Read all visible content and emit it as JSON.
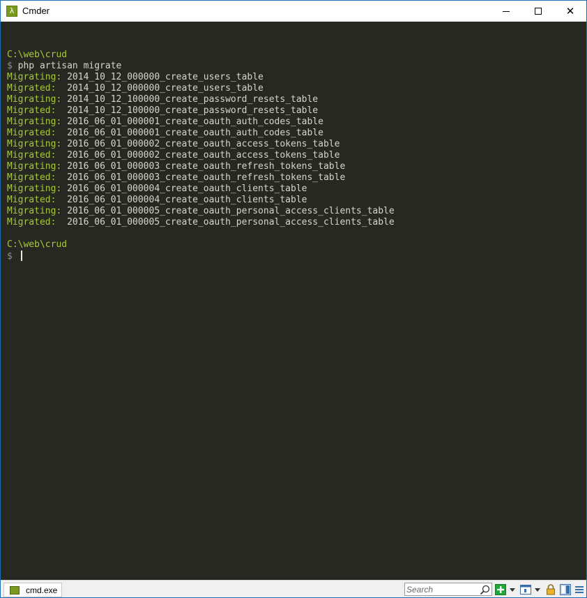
{
  "window": {
    "title": "Cmder",
    "app_icon_glyph": "λ"
  },
  "terminal": {
    "lines": [
      {
        "kind": "blank"
      },
      {
        "kind": "path",
        "text": "C:\\web\\crud"
      },
      {
        "kind": "prompt",
        "prompt": "$",
        "text": "php artisan migrate"
      },
      {
        "kind": "migration",
        "status": "Migrating:",
        "name": "2014_10_12_000000_create_users_table"
      },
      {
        "kind": "migration",
        "status": "Migrated: ",
        "name": "2014_10_12_000000_create_users_table"
      },
      {
        "kind": "migration",
        "status": "Migrating:",
        "name": "2014_10_12_100000_create_password_resets_table"
      },
      {
        "kind": "migration",
        "status": "Migrated: ",
        "name": "2014_10_12_100000_create_password_resets_table"
      },
      {
        "kind": "migration",
        "status": "Migrating:",
        "name": "2016_06_01_000001_create_oauth_auth_codes_table"
      },
      {
        "kind": "migration",
        "status": "Migrated: ",
        "name": "2016_06_01_000001_create_oauth_auth_codes_table"
      },
      {
        "kind": "migration",
        "status": "Migrating:",
        "name": "2016_06_01_000002_create_oauth_access_tokens_table"
      },
      {
        "kind": "migration",
        "status": "Migrated: ",
        "name": "2016_06_01_000002_create_oauth_access_tokens_table"
      },
      {
        "kind": "migration",
        "status": "Migrating:",
        "name": "2016_06_01_000003_create_oauth_refresh_tokens_table"
      },
      {
        "kind": "migration",
        "status": "Migrated: ",
        "name": "2016_06_01_000003_create_oauth_refresh_tokens_table"
      },
      {
        "kind": "migration",
        "status": "Migrating:",
        "name": "2016_06_01_000004_create_oauth_clients_table"
      },
      {
        "kind": "migration",
        "status": "Migrated: ",
        "name": "2016_06_01_000004_create_oauth_clients_table"
      },
      {
        "kind": "migration",
        "status": "Migrating:",
        "name": "2016_06_01_000005_create_oauth_personal_access_clients_table"
      },
      {
        "kind": "migration",
        "status": "Migrated: ",
        "name": "2016_06_01_000005_create_oauth_personal_access_clients_table"
      },
      {
        "kind": "blank"
      },
      {
        "kind": "path",
        "text": "C:\\web\\crud"
      },
      {
        "kind": "prompt",
        "prompt": "$",
        "text": "",
        "cursor": true
      }
    ]
  },
  "statusbar": {
    "tab_label": "cmd.exe",
    "search_placeholder": "Search"
  },
  "colors": {
    "terminal_bg": "#272822",
    "green": "#a6c93a",
    "text": "#d6d6cf",
    "prompt": "#8f908a"
  },
  "icons": {
    "search": "magnifier-icon",
    "new_console": "plus-icon",
    "console_list": "console-icon",
    "lock": "lock-icon",
    "split": "split-view-icon",
    "menu": "hamburger-icon"
  }
}
